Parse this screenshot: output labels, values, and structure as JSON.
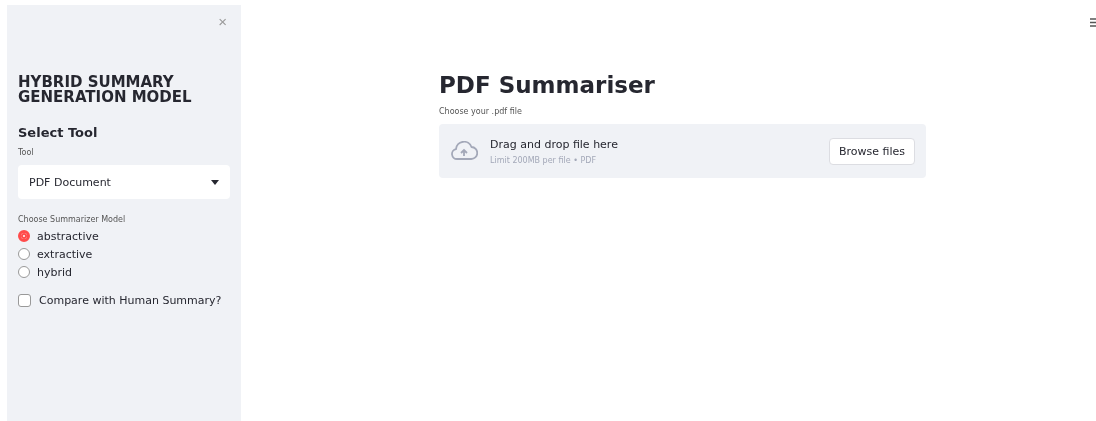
{
  "sidebar": {
    "close": "×",
    "title": "HYBRID SUMMARY GENERATION MODEL",
    "section": "Select Tool",
    "tool_label": "Tool",
    "tool_value": "PDF Document",
    "model_label": "Choose Summarizer Model",
    "models": [
      {
        "label": "abstractive",
        "selected": true
      },
      {
        "label": "extractive",
        "selected": false
      },
      {
        "label": "hybrid",
        "selected": false
      }
    ],
    "compare": {
      "label": "Compare with Human Summary?",
      "checked": false
    }
  },
  "main": {
    "title": "PDF Summariser",
    "upload_label": "Choose your .pdf file",
    "drop_text": "Drag and drop file here",
    "limit_text": "Limit 200MB per file • PDF",
    "browse": "Browse files"
  }
}
